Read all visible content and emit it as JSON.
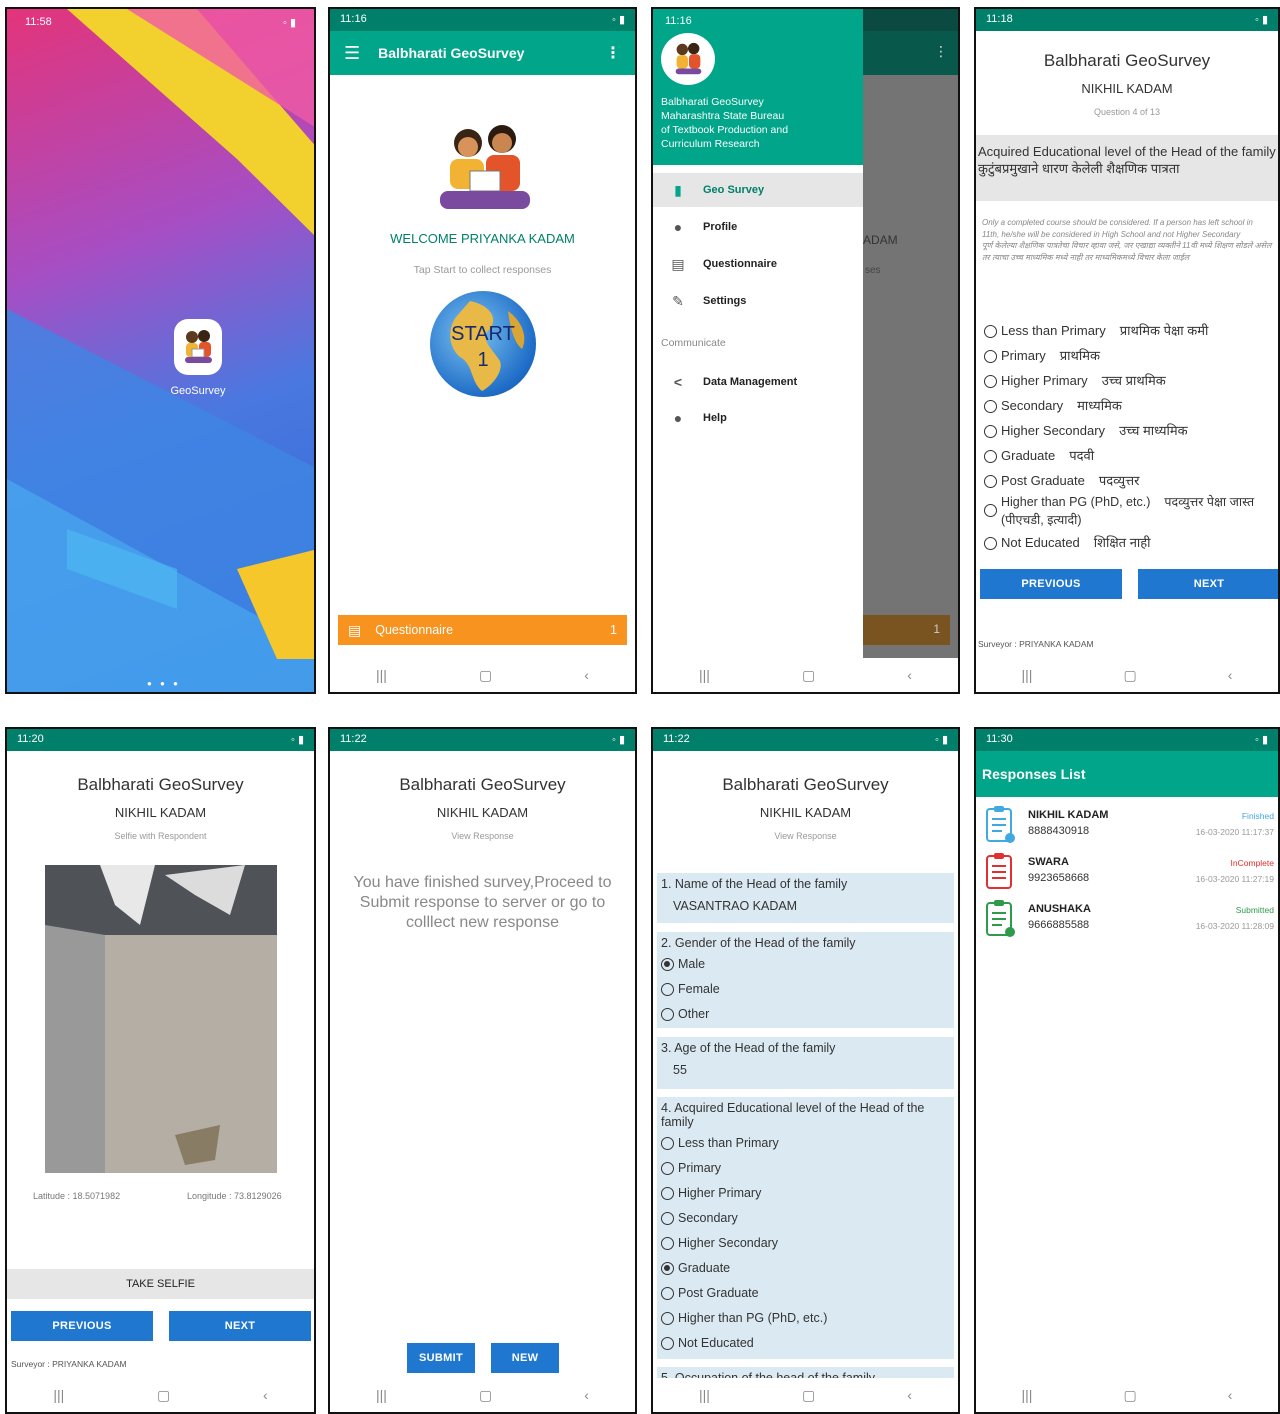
{
  "s1": {
    "time": "11:58",
    "app_label": "GeoSurvey"
  },
  "s2": {
    "time": "11:16",
    "title": "Balbharati GeoSurvey",
    "welcome": "WELCOME PRIYANKA KADAM",
    "tap_hint": "Tap Start to collect responses",
    "start_label": "START",
    "start_count": "1",
    "questionnaire_label": "Questionnaire",
    "questionnaire_count": "1"
  },
  "s3": {
    "time": "11:16",
    "drawer_line1": "Balbharati GeoSurvey",
    "drawer_line2": "Maharashtra State Bureau",
    "drawer_line3": "of Textbook Production and",
    "drawer_line4": "Curriculum Research",
    "menu_geo": "Geo Survey",
    "menu_profile": "Profile",
    "menu_questionnaire": "Questionnaire",
    "menu_settings": "Settings",
    "section_communicate": "Communicate",
    "menu_data": "Data Management",
    "menu_help": "Help",
    "behind_text1": "ADAM",
    "behind_text2": "ses",
    "behind_count": "1"
  },
  "s4": {
    "time": "11:18",
    "title": "Balbharati GeoSurvey",
    "name": "NIKHIL KADAM",
    "progress": "Question 4 of 13",
    "question_en": "Acquired Educational level of the Head of the family",
    "question_mr": "कुटुंबप्रमुखाने धारण केलेली शैक्षणिक पात्रता",
    "note_en": "Only a completed course should be considered. If a person has left school in 11th, he/she will be considered in High School and not Higher Secondary",
    "note_mr": "पूर्ण केलेल्या शैक्षणिक पात्रतेचा विचार व्हावा जसे, जर एखाद्या व्यक्तीने 11वी मध्ये शिक्षण सोडले असेल तर त्याचा उच्च माध्यमिक मध्ये नाही तर माध्यमिकमध्ये विचार केला जाईल",
    "options": [
      {
        "en": "Less than Primary",
        "mr": "प्राथमिक पेक्षा कमी"
      },
      {
        "en": "Primary",
        "mr": "प्राथमिक"
      },
      {
        "en": "Higher Primary",
        "mr": "उच्च प्राथमिक"
      },
      {
        "en": "Secondary",
        "mr": "माध्यमिक"
      },
      {
        "en": "Higher Secondary",
        "mr": "उच्च माध्यमिक"
      },
      {
        "en": "Graduate",
        "mr": "पदवी"
      },
      {
        "en": "Post Graduate",
        "mr": "पदव्युत्तर"
      },
      {
        "en": "Higher than PG (PhD, etc.)",
        "mr": "पदव्युत्तर पेक्षा जास्त",
        "mr2": "(पीएचडी, इत्यादी)"
      },
      {
        "en": "Not Educated",
        "mr": "शिक्षित नाही"
      }
    ],
    "prev_label": "PREVIOUS",
    "next_label": "NEXT",
    "surveyor": "Surveyor : PRIYANKA KADAM"
  },
  "s5": {
    "time": "11:20",
    "title": "Balbharati GeoSurvey",
    "name": "NIKHIL KADAM",
    "subtitle": "Selfie with Respondent",
    "latitude": "Latitude : 18.5071982",
    "longitude": "Longitude : 73.8129026",
    "take_selfie": "TAKE SELFIE",
    "prev_label": "PREVIOUS",
    "next_label": "NEXT",
    "surveyor": "Surveyor : PRIYANKA KADAM"
  },
  "s6": {
    "time": "11:22",
    "title": "Balbharati GeoSurvey",
    "name": "NIKHIL KADAM",
    "subtitle": "View Response",
    "message": "You have finished survey,Proceed to Submit response to server or go to colllect new response",
    "submit_label": "SUBMIT",
    "new_label": "NEW"
  },
  "s7": {
    "time": "11:22",
    "title": "Balbharati GeoSurvey",
    "name": "NIKHIL KADAM",
    "subtitle": "View Response",
    "q1": "1. Name of the Head of the family",
    "a1": "VASANTRAO KADAM",
    "q2": "2. Gender of the Head of the family",
    "gender_options": [
      "Male",
      "Female",
      "Other"
    ],
    "gender_selected": "Male",
    "q3": "3. Age of the Head of the family",
    "a3": "55",
    "q4": "4. Acquired Educational level of the Head of the family",
    "edu_options": [
      "Less than Primary",
      "Primary",
      "Higher Primary",
      "Secondary",
      "Higher Secondary",
      "Graduate",
      "Post Graduate",
      "Higher than PG (PhD, etc.)",
      "Not Educated"
    ],
    "edu_selected": "Graduate",
    "q5": "5. Occupation of the head of the family"
  },
  "s8": {
    "time": "11:30",
    "title": "Responses List",
    "responses": [
      {
        "name": "NIKHIL KADAM",
        "phone": "8888430918",
        "status": "Finished",
        "date": "16-03-2020 11:17:37",
        "status_color": "#3fa9e0"
      },
      {
        "name": "SWARA",
        "phone": "9923658668",
        "status": "InComplete",
        "date": "16-03-2020 11:27:19",
        "status_color": "#e03030"
      },
      {
        "name": "ANUSHAKA",
        "phone": "9666885588",
        "status": "Submitted",
        "date": "16-03-2020 11:28:09",
        "status_color": "#2e9b4b"
      }
    ]
  },
  "colors": {
    "primary": "#00a58a",
    "statusbar": "#00806a",
    "accent": "#f7931e",
    "button": "#1f77cf",
    "qblock": "#dbe9f2"
  }
}
